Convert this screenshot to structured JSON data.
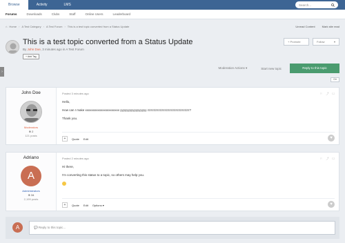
{
  "topnav": {
    "tabs": [
      "Browse",
      "Activity",
      "LMS"
    ],
    "search_placeholder": "Search..."
  },
  "subnav": {
    "items": [
      "Forums",
      "Downloads",
      "Clubs",
      "Staff",
      "Online Users",
      "Leaderboard"
    ]
  },
  "breadcrumb": {
    "items": [
      "Home",
      "A Test Category",
      "A Test Forum",
      "This is a test topic converted from a Status Update"
    ],
    "unread": "Unread Content",
    "mark_read": "Mark site read"
  },
  "topic": {
    "title": "This is a test topic converted from a Status Update",
    "by": "By",
    "author": "John Doe",
    "time": ", 3 minutes ago in A Test Forum",
    "add_tag": "Add Tag",
    "promote": "Promote",
    "follow": "Follow"
  },
  "actions": {
    "moderation": "Moderation Actions ▾",
    "start_new": "Start new topic",
    "reply": "Reply to this topic"
  },
  "posts": [
    {
      "author": "John Doe",
      "group": "Moderators",
      "rep": "2",
      "count": "121 posts",
      "meta": "Posted 3 minutes ago",
      "lines": [
        "Hello,",
        "How can I make xxxxxxxxxxxxxxxxxxxxxx yyyyyyyyyyyyyyyyy zzzzzzzzzzzzzzzzzzzzzzzzzzz?",
        "Thank you."
      ],
      "quote": "Quote",
      "edit": "Edit"
    },
    {
      "author": "Adriano",
      "initial": "A",
      "group": "Administrators",
      "rep": "34",
      "count": "2,199 posts",
      "meta": "Posted 2 minutes ago",
      "lines": [
        "Hi there,",
        "I'm converting this status to a topic, so others may help you."
      ],
      "quote": "Quote",
      "edit": "Edit",
      "options": "Options ▾"
    }
  ],
  "reply_box": {
    "initial": "A",
    "placeholder": "Reply to this topic..."
  },
  "colors": {
    "brand": "#3d6594",
    "reply_button": "#4a9b6f",
    "moderator": "#e35d3b",
    "admin": "#2c5fb4"
  }
}
